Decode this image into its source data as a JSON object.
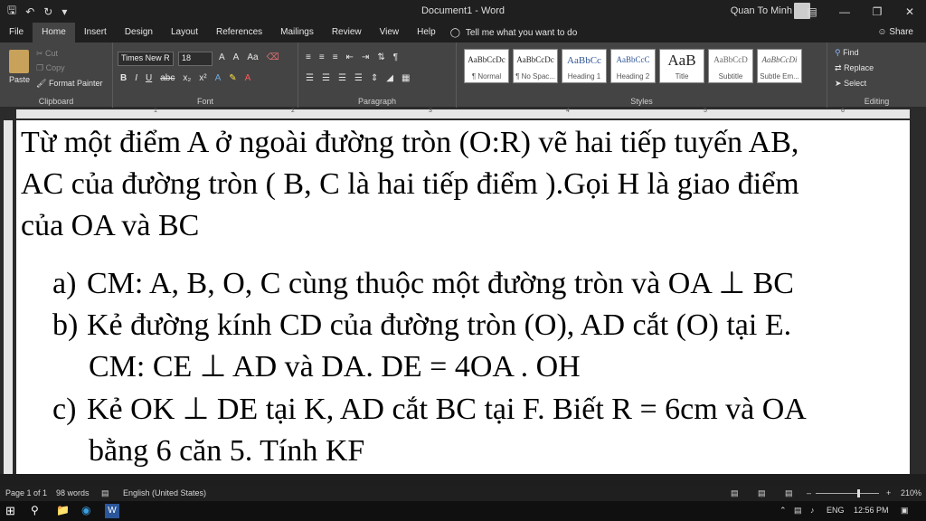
{
  "window": {
    "title": "Document1 - Word",
    "user": "Quan To Minh"
  },
  "tabs": [
    "File",
    "Home",
    "Insert",
    "Design",
    "Layout",
    "References",
    "Mailings",
    "Review",
    "View",
    "Help"
  ],
  "tell_me": "Tell me what you want to do",
  "share": "Share",
  "clipboard": {
    "paste": "Paste",
    "cut": "Cut",
    "copy": "Copy",
    "format_painter": "Format Painter",
    "label": "Clipboard"
  },
  "font": {
    "name": "Times New R",
    "size": "18",
    "label": "Font",
    "grow": "A",
    "shrink": "A",
    "case": "Aa"
  },
  "paragraph": {
    "label": "Paragraph"
  },
  "styles": {
    "label": "Styles",
    "items": [
      {
        "sample": "AaBbCcDc",
        "name": "¶ Normal"
      },
      {
        "sample": "AaBbCcDc",
        "name": "¶ No Spac..."
      },
      {
        "sample": "AaBbCc",
        "name": "Heading 1"
      },
      {
        "sample": "AaBbCcC",
        "name": "Heading 2"
      },
      {
        "sample": "AaB",
        "name": "Title"
      },
      {
        "sample": "AaBbCcD",
        "name": "Subtitle"
      },
      {
        "sample": "AaBbCcDi",
        "name": "Subtle Em..."
      }
    ]
  },
  "editing": {
    "find": "Find",
    "replace": "Replace",
    "select": "Select",
    "label": "Editing"
  },
  "ruler_numbers": [
    "1",
    "2",
    "3",
    "4",
    "5",
    "6"
  ],
  "document": {
    "intro_lines": [
      "Từ một điểm A ở ngoài đường tròn (O:R) vẽ hai tiếp tuyến AB,",
      "AC của đường tròn ( B, C là hai tiếp điểm ).Gọi H là giao điểm",
      "của OA và BC"
    ],
    "items": [
      {
        "marker": "a)",
        "lines": [
          "CM: A, B, O, C cùng thuộc một đường tròn và OA ⊥ BC"
        ]
      },
      {
        "marker": "b)",
        "lines": [
          "Kẻ đường kính CD của đường tròn (O), AD cắt (O) tại E.",
          "CM: CE ⊥ AD và DA. DE = 4OA . OH"
        ]
      },
      {
        "marker": "c)",
        "lines": [
          "Kẻ OK ⊥ DE tại K, AD cắt BC tại F. Biết R = 6cm và OA",
          "bằng 6 căn 5. Tính KF"
        ]
      }
    ]
  },
  "status": {
    "page": "Page 1 of 1",
    "words": "98 words",
    "language": "English (United States)",
    "zoom": "210%"
  },
  "taskbar": {
    "lang": "ENG",
    "time": "12:56 PM"
  },
  "colors": {
    "word_blue": "#2b579a",
    "ribbon": "#444444",
    "dark": "#1f1f1f"
  }
}
